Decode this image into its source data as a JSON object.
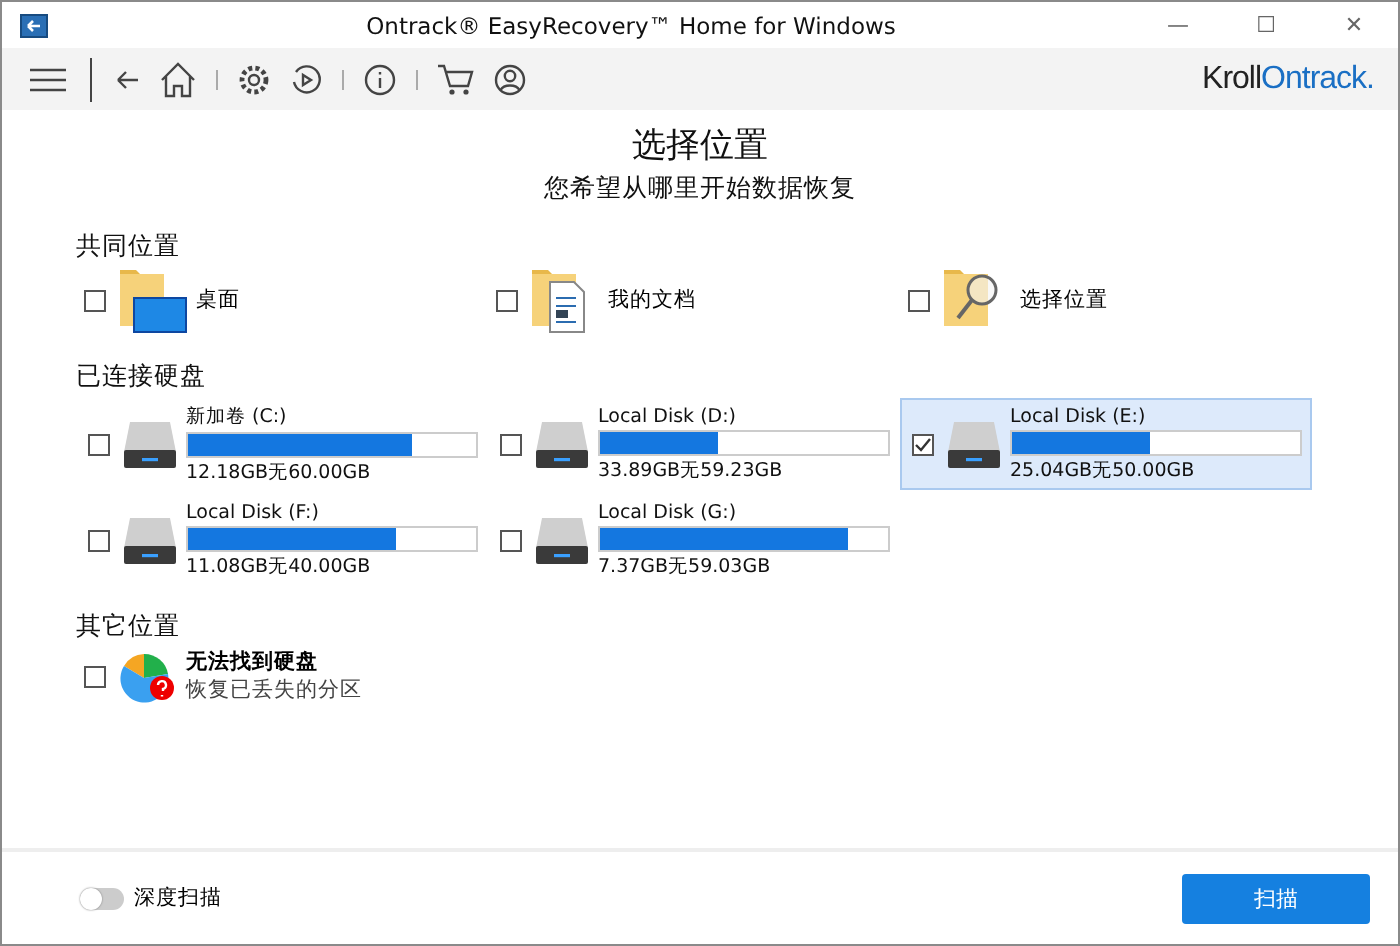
{
  "window": {
    "title": "Ontrack® EasyRecovery™ Home for Windows",
    "controls": [
      "—",
      "☐",
      "✕"
    ]
  },
  "toolbar": {
    "logo": {
      "part1": "Kroll",
      "part2": "Ontrack",
      "dot": "."
    }
  },
  "heading": {
    "title": "选择位置",
    "subtitle": "您希望从哪里开始数据恢复"
  },
  "common": {
    "title": "共同位置",
    "items": [
      {
        "label": "桌面",
        "kind": "desktop",
        "checked": false
      },
      {
        "label": "我的文档",
        "kind": "documents",
        "checked": false
      },
      {
        "label": "选择位置",
        "kind": "browse",
        "checked": false
      }
    ]
  },
  "disks": {
    "title": "已连接硬盘",
    "items": [
      {
        "name": "新加卷 (C:)",
        "reading": "12.18GB无60.00GB",
        "level": 0.78,
        "checked": false,
        "selected": false
      },
      {
        "name": "Local Disk (D:)",
        "reading": "33.89GB无59.23GB",
        "level": 0.41,
        "checked": false,
        "selected": false
      },
      {
        "name": "Local Disk (E:)",
        "reading": "25.04GB无50.00GB",
        "level": 0.48,
        "checked": true,
        "selected": true
      },
      {
        "name": "Local Disk (F:)",
        "reading": "11.08GB无40.00GB",
        "level": 0.72,
        "checked": false,
        "selected": false
      },
      {
        "name": "Local Disk (G:)",
        "reading": "7.37GB无59.03GB",
        "level": 0.86,
        "checked": false,
        "selected": false
      }
    ]
  },
  "other": {
    "title": "其它位置",
    "items": [
      {
        "title": "无法找到硬盘",
        "subtitle": "恢复已丢失的分区",
        "checked": false
      }
    ]
  },
  "footer": {
    "deep_scan": {
      "label": "深度扫描",
      "on": false
    },
    "scan_button": "扫描"
  }
}
